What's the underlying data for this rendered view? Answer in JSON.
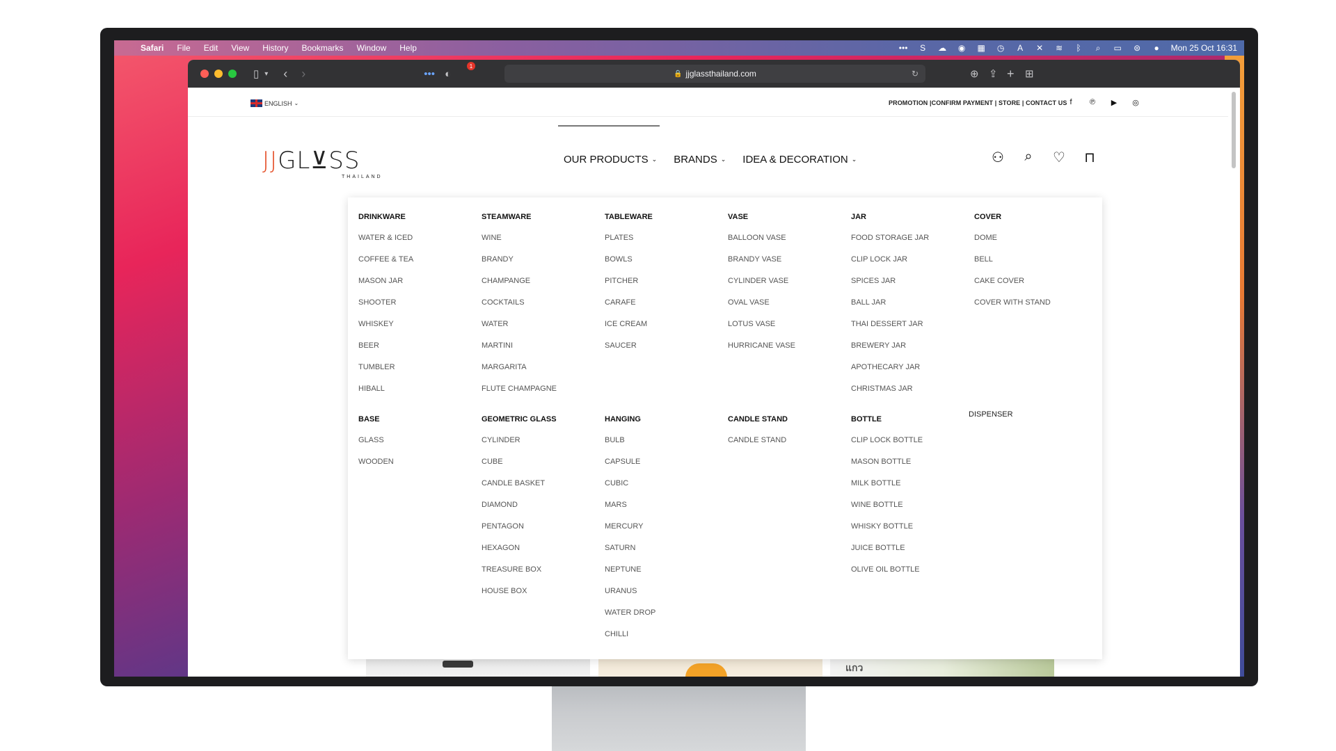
{
  "menubar": {
    "app": "Safari",
    "items": [
      "File",
      "Edit",
      "View",
      "History",
      "Bookmarks",
      "Window",
      "Help"
    ],
    "datetime": "Mon 25 Oct  16:31"
  },
  "browser": {
    "url": "jjglassthailand.com",
    "badge": "1"
  },
  "site": {
    "language": "ENGLISH",
    "top_links": "PROMOTION |CONFIRM PAYMENT | STORE | CONTACT US",
    "logo_main_a": "JJ",
    "logo_main_b": "GL⊻SS",
    "logo_sub": "THAILAND",
    "nav": [
      "OUR PRODUCTS",
      "BRANDS",
      "IDEA & DECORATION"
    ]
  },
  "mega": {
    "drinkware": {
      "title": "DRINKWARE",
      "items": [
        "WATER & ICED",
        "COFFEE & TEA",
        "MASON JAR",
        "SHOOTER",
        "WHISKEY",
        "BEER",
        "TUMBLER",
        "HIBALL"
      ]
    },
    "steamware": {
      "title": "STEAMWARE",
      "items": [
        "WINE",
        "BRANDY",
        "CHAMPANGE",
        "COCKTAILS",
        "WATER",
        "MARTINI",
        "MARGARITA",
        "FLUTE CHAMPAGNE"
      ]
    },
    "tableware": {
      "title": "TABLEWARE",
      "items": [
        "PLATES",
        "BOWLS",
        "PITCHER",
        "CARAFE",
        "ICE CREAM",
        "SAUCER"
      ]
    },
    "vase": {
      "title": "VASE",
      "items": [
        "BALLOON VASE",
        "BRANDY VASE",
        "CYLINDER VASE",
        "OVAL VASE",
        "LOTUS VASE",
        "HURRICANE VASE"
      ]
    },
    "jar": {
      "title": "JAR",
      "items": [
        "FOOD STORAGE JAR",
        "CLIP LOCK JAR",
        "SPICES JAR",
        "BALL JAR",
        "THAI DESSERT JAR",
        "BREWERY JAR",
        "APOTHECARY JAR",
        "CHRISTMAS JAR"
      ]
    },
    "cover": {
      "title": "COVER",
      "items": [
        "DOME",
        "BELL",
        "CAKE COVER",
        "COVER WITH STAND"
      ]
    },
    "dispenser": {
      "title": "DISPENSER"
    },
    "base": {
      "title": "BASE",
      "items": [
        "GLASS",
        "WOODEN"
      ]
    },
    "geometric": {
      "title": "GEOMETRIC GLASS",
      "items": [
        "CYLINDER",
        "CUBE",
        "CANDLE BASKET",
        "DIAMOND",
        "PENTAGON",
        "HEXAGON",
        "TREASURE BOX",
        "HOUSE BOX"
      ]
    },
    "hanging": {
      "title": "HANGING",
      "items": [
        "BULB",
        "CAPSULE",
        "CUBIC",
        "MARS",
        "MERCURY",
        "SATURN",
        "NEPTUNE",
        "URANUS",
        "WATER DROP",
        "CHILLI"
      ]
    },
    "candle": {
      "title": "CANDLE STAND",
      "items": [
        "CANDLE STAND"
      ]
    },
    "bottle": {
      "title": "BOTTLE",
      "items": [
        "CLIP LOCK BOTTLE",
        "MASON BOTTLE",
        "MILK BOTTLE",
        "WINE BOTTLE",
        "WHISKY BOTTLE",
        "JUICE BOTTLE",
        "OLIVE OIL BOTTLE"
      ]
    }
  },
  "product_peek_text": "แกว",
  "colors": {
    "accent": "#e5512a",
    "toolbar": "#323234"
  }
}
